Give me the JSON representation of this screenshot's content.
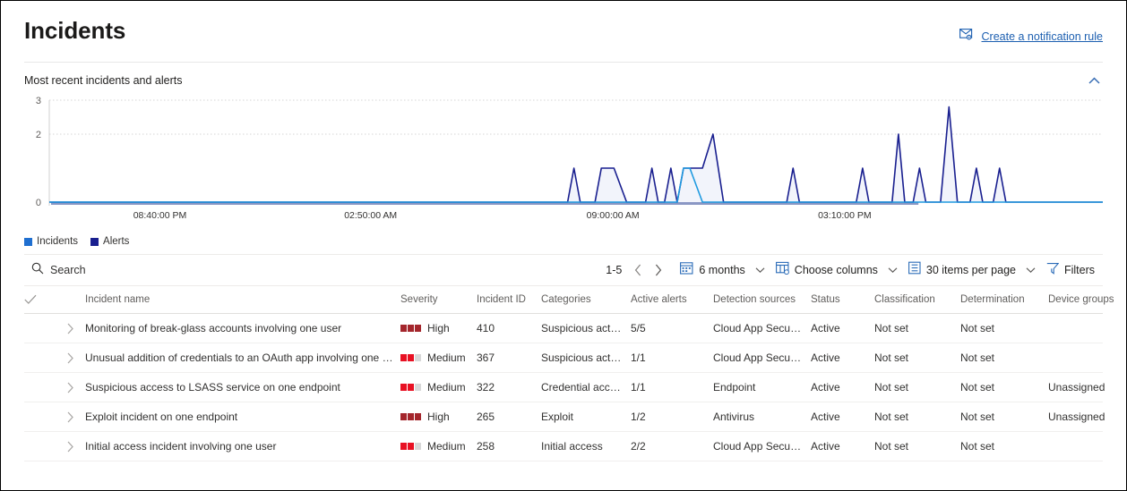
{
  "header": {
    "title": "Incidents",
    "notification_rule_label": "Create a notification rule",
    "notification_rule_icon": "mail-settings-icon"
  },
  "chart_panel": {
    "title": "Most recent incidents and alerts",
    "collapse_icon": "chevron-up-icon"
  },
  "legend": [
    {
      "label": "Incidents",
      "color": "#1f6fd0"
    },
    {
      "label": "Alerts",
      "color": "#191f8f"
    }
  ],
  "toolbar": {
    "search_placeholder": "Search",
    "search_icon": "search-icon",
    "page_range": "1-5",
    "prev_icon": "chevron-left-icon",
    "next_icon": "chevron-right-icon",
    "date_range": "6 months",
    "date_range_icon": "calendar-icon",
    "choose_columns": "Choose columns",
    "choose_columns_icon": "columns-icon",
    "items_per_page": "30 items per page",
    "items_per_page_icon": "list-icon",
    "filters": "Filters",
    "filters_icon": "funnel-icon",
    "caret_icon": "chevron-down-icon"
  },
  "table": {
    "select_all_icon": "checkmark-icon",
    "expand_icon": "chevron-right-icon",
    "columns": [
      "Incident name",
      "Severity",
      "Incident ID",
      "Categories",
      "Active alerts",
      "Detection sources",
      "Status",
      "Classification",
      "Determination",
      "Device groups"
    ],
    "rows": [
      {
        "name": "Monitoring of break-glass accounts involving one user",
        "severity": "High",
        "severity_level": 3,
        "id": "410",
        "category": "Suspicious activi...",
        "active_alerts": "5/5",
        "detection_source": "Cloud App Security",
        "status": "Active",
        "classification": "Not set",
        "determination": "Not set",
        "device_groups": ""
      },
      {
        "name": "Unusual addition of credentials to an OAuth app involving one user",
        "severity": "Medium",
        "severity_level": 2,
        "id": "367",
        "category": "Suspicious activi...",
        "active_alerts": "1/1",
        "detection_source": "Cloud App Security",
        "status": "Active",
        "classification": "Not set",
        "determination": "Not set",
        "device_groups": ""
      },
      {
        "name": "Suspicious access to LSASS service on one endpoint",
        "severity": "Medium",
        "severity_level": 2,
        "id": "322",
        "category": "Credential access",
        "active_alerts": "1/1",
        "detection_source": "Endpoint",
        "status": "Active",
        "classification": "Not set",
        "determination": "Not set",
        "device_groups": "Unassigned"
      },
      {
        "name": "Exploit incident on one endpoint",
        "severity": "High",
        "severity_level": 3,
        "id": "265",
        "category": "Exploit",
        "active_alerts": "1/2",
        "detection_source": "Antivirus",
        "status": "Active",
        "classification": "Not set",
        "determination": "Not set",
        "device_groups": "Unassigned"
      },
      {
        "name": "Initial access incident involving one user",
        "severity": "Medium",
        "severity_level": 2,
        "id": "258",
        "category": "Initial access",
        "active_alerts": "2/2",
        "detection_source": "Cloud App Security",
        "status": "Active",
        "classification": "Not set",
        "determination": "Not set",
        "device_groups": ""
      }
    ]
  },
  "colors": {
    "link": "#1c5fb0",
    "accent": "#0078d4",
    "alerts_line": "#191f8f",
    "incidents_line": "#1f9ae0",
    "severity_high": "#a4262c",
    "severity_medium": "#e81123",
    "severity_empty": "#d8d8d8"
  },
  "chart_data": {
    "type": "line",
    "title": "Most recent incidents and alerts",
    "xlabel": "",
    "ylabel": "",
    "ylim": [
      0,
      3
    ],
    "yticks": [
      0,
      2,
      3
    ],
    "grid": true,
    "legend_position": "bottom-left",
    "xticks": [
      "08:40:00 PM",
      "02:50:00 AM",
      "09:00:00 AM",
      "03:10:00 PM"
    ],
    "xtick_positions": [
      0.105,
      0.305,
      0.535,
      0.755
    ],
    "series": [
      {
        "name": "Alerts",
        "color": "#191f8f",
        "points": [
          [
            0.0,
            0
          ],
          [
            0.48,
            0
          ],
          [
            0.492,
            0
          ],
          [
            0.498,
            1
          ],
          [
            0.504,
            0
          ],
          [
            0.518,
            0
          ],
          [
            0.524,
            1
          ],
          [
            0.536,
            1
          ],
          [
            0.548,
            0
          ],
          [
            0.566,
            0
          ],
          [
            0.572,
            1
          ],
          [
            0.578,
            0
          ],
          [
            0.584,
            0
          ],
          [
            0.59,
            1
          ],
          [
            0.596,
            0
          ],
          [
            0.602,
            1
          ],
          [
            0.62,
            1
          ],
          [
            0.63,
            2
          ],
          [
            0.64,
            0
          ],
          [
            0.7,
            0
          ],
          [
            0.706,
            1
          ],
          [
            0.712,
            0
          ],
          [
            0.766,
            0
          ],
          [
            0.772,
            1
          ],
          [
            0.778,
            0
          ],
          [
            0.8,
            0
          ],
          [
            0.806,
            2
          ],
          [
            0.812,
            0
          ],
          [
            0.82,
            0
          ],
          [
            0.826,
            1
          ],
          [
            0.832,
            0
          ],
          [
            0.846,
            0
          ],
          [
            0.854,
            2.8
          ],
          [
            0.862,
            0
          ],
          [
            0.874,
            0
          ],
          [
            0.88,
            1
          ],
          [
            0.886,
            0
          ],
          [
            0.896,
            0
          ],
          [
            0.902,
            1
          ],
          [
            0.908,
            0
          ],
          [
            1.0,
            0
          ]
        ]
      },
      {
        "name": "Incidents",
        "color": "#1f9ae0",
        "points": [
          [
            0.0,
            0
          ],
          [
            0.596,
            0
          ],
          [
            0.602,
            1
          ],
          [
            0.608,
            1
          ],
          [
            0.62,
            0
          ],
          [
            1.0,
            0
          ]
        ]
      }
    ]
  }
}
